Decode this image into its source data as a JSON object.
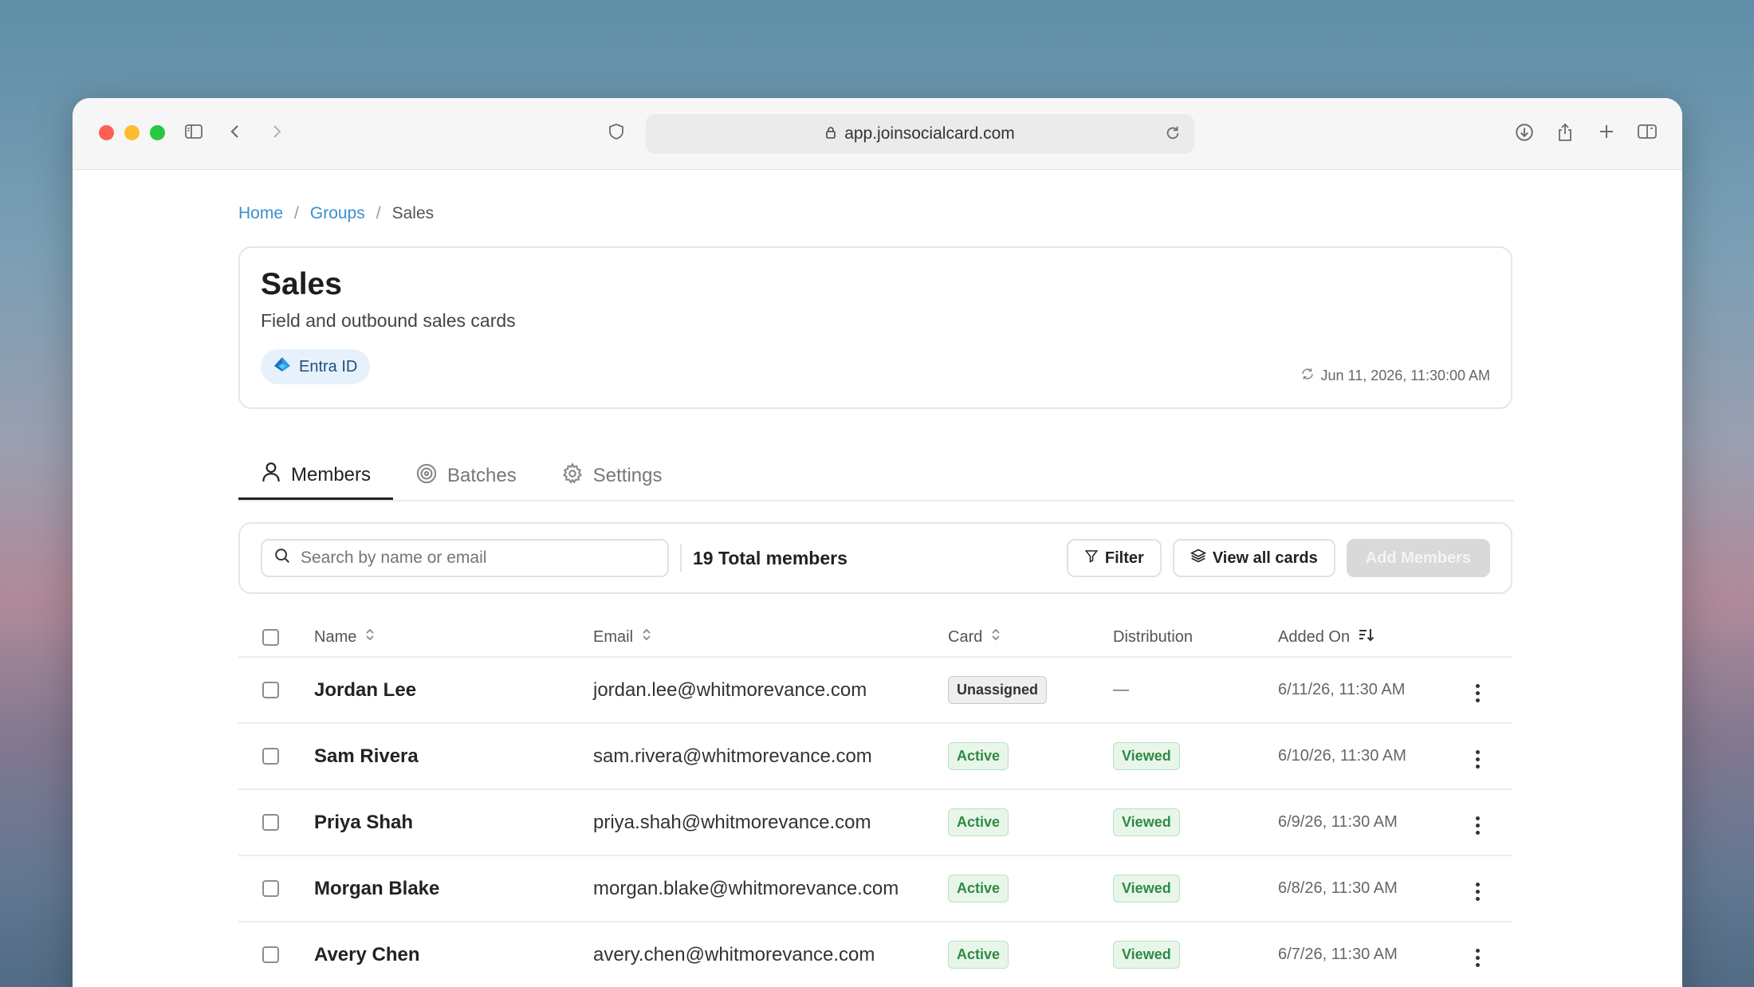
{
  "browser": {
    "url": "app.joinsocialcard.com"
  },
  "breadcrumb": {
    "home": "Home",
    "groups": "Groups",
    "current": "Sales",
    "separator": "/"
  },
  "group": {
    "title": "Sales",
    "description": "Field and outbound sales cards",
    "badge": "Entra ID",
    "sync_time": "Jun 11, 2026, 11:30:00 AM"
  },
  "tabs": [
    {
      "label": "Members",
      "icon": "person-icon",
      "active": true
    },
    {
      "label": "Batches",
      "icon": "batches-icon",
      "active": false
    },
    {
      "label": "Settings",
      "icon": "gear-icon",
      "active": false
    }
  ],
  "toolbar": {
    "search_placeholder": "Search by name or email",
    "total_members": "19 Total members",
    "filter_label": "Filter",
    "view_all_label": "View all cards",
    "add_members_label": "Add Members"
  },
  "table": {
    "columns": {
      "name": "Name",
      "email": "Email",
      "card": "Card",
      "distribution": "Distribution",
      "added_on": "Added On"
    },
    "rows": [
      {
        "name": "Jordan Lee",
        "email": "jordan.lee@whitmorevance.com",
        "card": "Unassigned",
        "distribution": "—",
        "added": "6/11/26, 11:30 AM"
      },
      {
        "name": "Sam Rivera",
        "email": "sam.rivera@whitmorevance.com",
        "card": "Active",
        "distribution": "Viewed",
        "added": "6/10/26, 11:30 AM"
      },
      {
        "name": "Priya Shah",
        "email": "priya.shah@whitmorevance.com",
        "card": "Active",
        "distribution": "Viewed",
        "added": "6/9/26, 11:30 AM"
      },
      {
        "name": "Morgan Blake",
        "email": "morgan.blake@whitmorevance.com",
        "card": "Active",
        "distribution": "Viewed",
        "added": "6/8/26, 11:30 AM"
      },
      {
        "name": "Avery Chen",
        "email": "avery.chen@whitmorevance.com",
        "card": "Active",
        "distribution": "Viewed",
        "added": "6/7/26, 11:30 AM"
      }
    ]
  },
  "colors": {
    "link": "#3a8fd0",
    "active_green": "#2f8a43",
    "badge_bg": "#e7f1fb"
  }
}
